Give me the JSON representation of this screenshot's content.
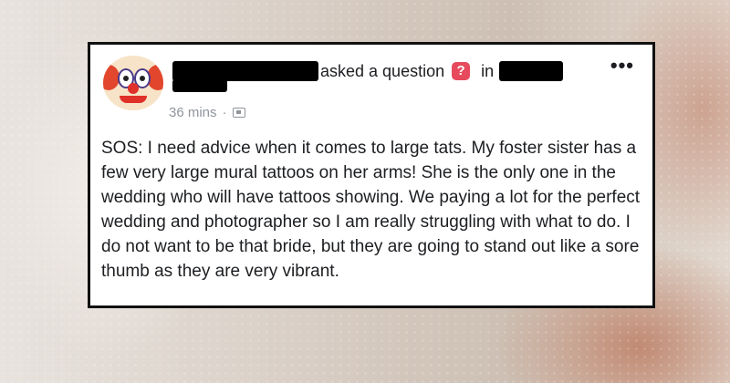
{
  "post": {
    "action_text": "asked a question",
    "in_text": "in",
    "question_icon": "?",
    "more_label": "•••",
    "timestamp": "36 mins",
    "separator": "·",
    "privacy_icon": "group-icon",
    "body": "SOS: I need advice when it comes to large tats. My foster sister has a few very large mural tattoos on her arms! She is the only one in the wedding who will have tattoos showing. We paying a lot for the perfect wedding and photographer so I am really struggling with what to do. I do not want to be that bride, but they are going to stand out like a sore thumb as they are very vibrant."
  },
  "colors": {
    "question_badge": "#e64a5c",
    "meta_text": "#90949c",
    "body_text": "#1c1e21"
  }
}
